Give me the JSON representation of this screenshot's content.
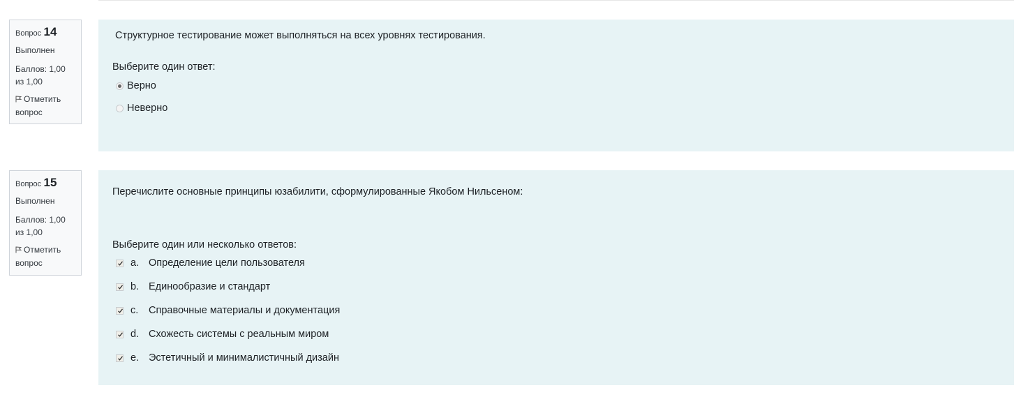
{
  "questions": [
    {
      "label": "Вопрос",
      "number": "14",
      "state": "Выполнен",
      "grade": "Баллов: 1,00 из 1,00",
      "flag": "Отметить вопрос",
      "text": "Структурное тестирование может выполняться на всех уровнях тестирования.",
      "prompt": "Выберите один ответ:",
      "answers": [
        {
          "label": "Верно",
          "selected": true
        },
        {
          "label": "Неверно",
          "selected": false
        }
      ]
    },
    {
      "label": "Вопрос",
      "number": "15",
      "state": "Выполнен",
      "grade": "Баллов: 1,00 из 1,00",
      "flag": "Отметить вопрос",
      "text": "Перечислите основные принципы юзабилити, сформулированные Якобом Нильсеном:",
      "prompt": "Выберите один или несколько ответов:",
      "answers": [
        {
          "num": "a.",
          "label": "Определение цели пользователя",
          "checked": true
        },
        {
          "num": "b.",
          "label": "Единообразие и стандарт",
          "checked": true
        },
        {
          "num": "c.",
          "label": "Справочные материалы и документация",
          "checked": true
        },
        {
          "num": "d.",
          "label": "Схожесть системы с реальным миром",
          "checked": true
        },
        {
          "num": "e.",
          "label": "Эстетичный и минималистичный дизайн",
          "checked": true
        }
      ]
    }
  ],
  "colors": {
    "content_bg": "#e7f3f5",
    "info_bg": "#f8f9fa"
  }
}
